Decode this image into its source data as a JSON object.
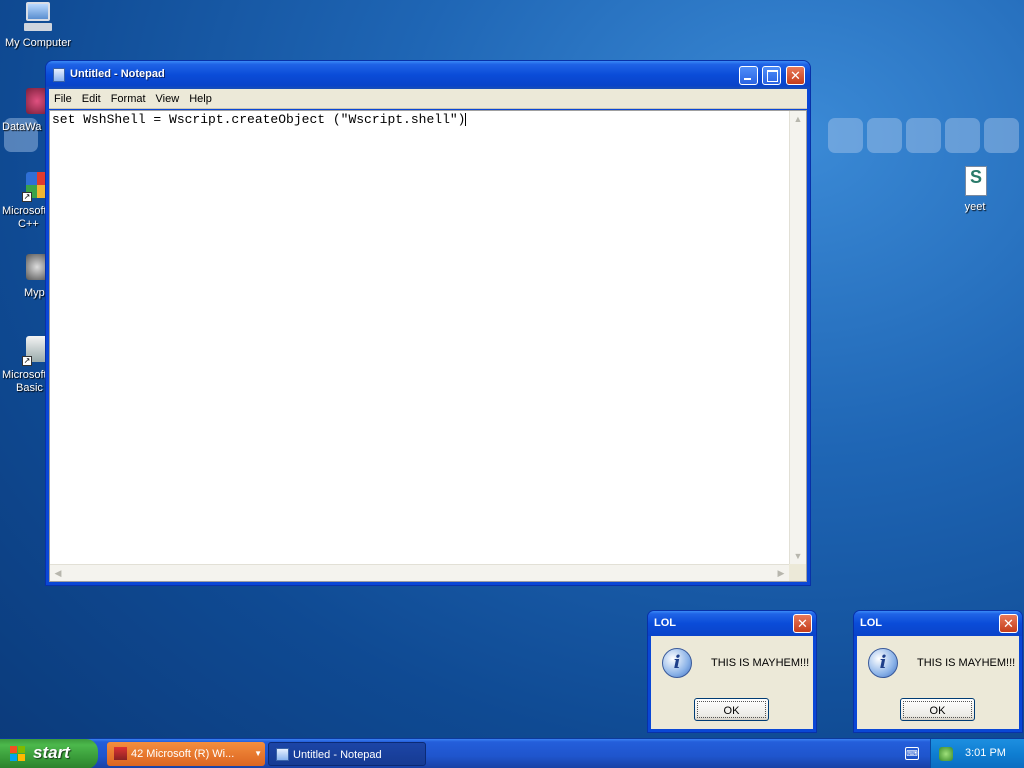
{
  "desktop": {
    "icons": [
      {
        "label": "My Computer",
        "icon": "my-computer-icon"
      },
      {
        "label": "DataWa",
        "icon": "datawarehouse-icon"
      },
      {
        "label": "Microsoft C++",
        "label_line1": "Microsoft",
        "label_line2": "C++",
        "icon": "microsoft-cpp-icon"
      },
      {
        "label": "Myp",
        "icon": "myp-icon"
      },
      {
        "label": "Microsoft Basic",
        "label_line1": "Microsoft",
        "label_line2": "Basic",
        "icon": "microsoft-basic-icon"
      },
      {
        "label": "yeet",
        "icon": "script-file-icon"
      }
    ]
  },
  "notepad": {
    "title": "Untitled - Notepad",
    "menu": [
      "File",
      "Edit",
      "Format",
      "View",
      "Help"
    ],
    "content": "set WshShell = Wscript.createObject (\"Wscript.shell\")"
  },
  "dialogs": [
    {
      "title": "LOL",
      "message": "THIS IS MAYHEM!!!",
      "ok_label": "OK",
      "icon": "information-icon"
    },
    {
      "title": "LOL",
      "message": "THIS IS MAYHEM!!!",
      "ok_label": "OK",
      "icon": "information-icon"
    }
  ],
  "taskbar": {
    "start_label": "start",
    "tasks": [
      {
        "label": "42 Microsoft (R) Wi...",
        "active": false,
        "color": "#e86f2a"
      },
      {
        "label": "Untitled - Notepad",
        "active": true,
        "color": "#163b93"
      }
    ],
    "clock": "3:01 PM"
  }
}
